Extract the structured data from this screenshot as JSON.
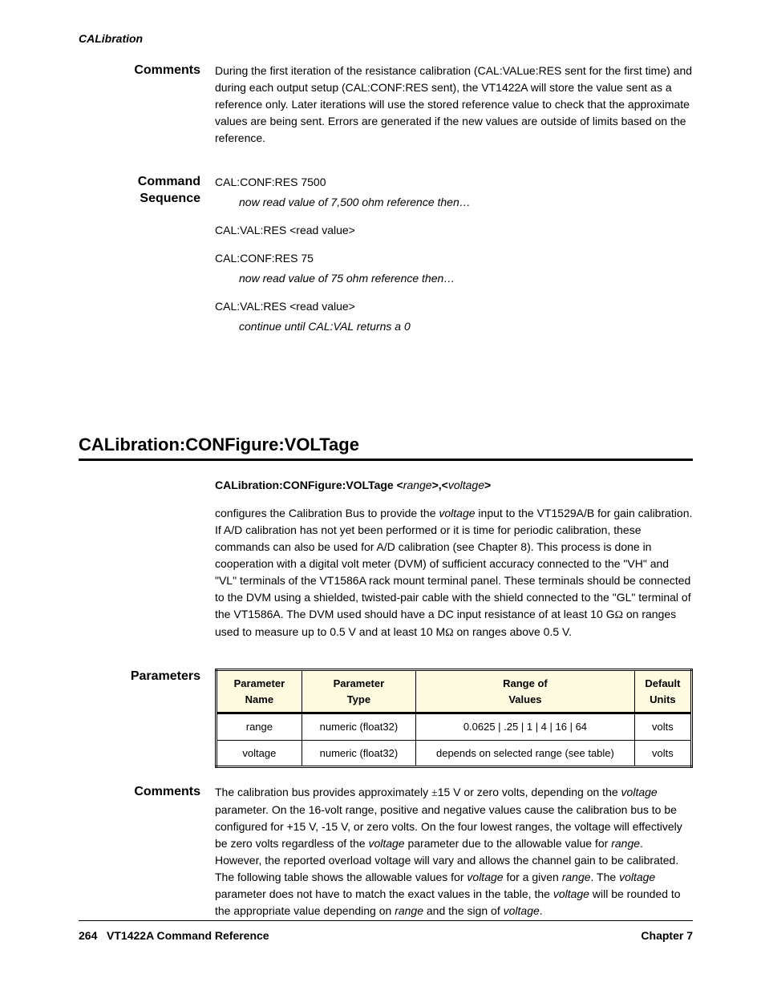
{
  "header": {
    "running": "CALibration"
  },
  "section1": {
    "label": "Comments",
    "paragraphs": [
      "During the first iteration of the resistance calibration (CAL:VALue:RES sent for the first time) and during each output setup (CAL:CONF:RES sent), the VT1422A will store the value sent as a reference only. Later iterations will use the stored reference value to check that the approximate values are being sent. Errors are generated if the new values are outside of limits based on the reference."
    ]
  },
  "section2": {
    "label": "Command\nSequence",
    "lines": [
      "CAL:CONF:RES 7500",
      "now read value of 7,500 ohm reference then…",
      "CAL:VAL:RES <read value>",
      "CAL:CONF:RES 75",
      "now read value of 75 ohm reference then…",
      "CAL:VAL:RES <read value>",
      "continue until CAL:VAL returns a 0"
    ]
  },
  "title": "CALibration:CONFigure:VOLTage",
  "syntax": {
    "cmd": "CALibration:CONFigure:VOLTage",
    "p1": "range",
    "p2": "voltage"
  },
  "desc_paragraphs": [
    [
      "configures the Calibration Bus to provide the ",
      "voltage",
      " input to the VT1529A/B for gain calibration. If A/D calibration has not yet been performed or it is time for periodic calibration, these commands can also be used for A/D calibration (see Chapter 8). This process is done in cooperation with a digital volt meter (DVM) of sufficient accuracy connected to the \"VH\" and \"VL\" terminals of the VT1586A rack mount terminal panel. These terminals should be connected to the DVM using a shielded, twisted-pair cable with the shield connected to the \"GL\" terminal of the VT1586A. The DVM used should have a DC input resistance of at least 10 G",
      " on ranges used to measure up to 0.5 V and at least 10 M",
      " on ranges above 0.5 V."
    ]
  ],
  "params_label": "Parameters",
  "param_table": {
    "headers": [
      "Parameter\nName",
      "Parameter\nType",
      "Range of\nValues",
      "Default\nUnits"
    ],
    "rows": [
      [
        "range",
        "numeric (float32)",
        "0.0625 | .25 | 1 | 4 | 16 | 64",
        "volts"
      ],
      [
        "voltage",
        "numeric (float32)",
        "depends on selected range (see table)",
        "volts"
      ]
    ]
  },
  "section3": {
    "label": "Comments",
    "paragraphs": [
      [
        "The calibration bus provides approximately ",
        "15 V or zero volts, depending on the ",
        "voltage",
        " parameter. On the 16-volt range, positive and negative values cause the calibration bus to be configured for +15 V, -15 V, or zero volts. On the four lowest ranges, the voltage will effectively be zero volts regardless of the ",
        "voltage",
        " parameter due to the allowable value for ",
        "range",
        ". However, the reported overload voltage will vary and allows the channel gain to be calibrated. The following table shows the allowable values for ",
        "voltage",
        " for a given ",
        "range",
        ". The ",
        "voltage",
        " parameter does not have to match the exact values in the table, the ",
        "voltage",
        " will be rounded to the appropriate value depending on ",
        "range",
        " and the sign of ",
        "voltage",
        "."
      ]
    ]
  },
  "footer": {
    "page": "264",
    "title": "VT1422A Command Reference",
    "chapter": "Chapter 7"
  }
}
